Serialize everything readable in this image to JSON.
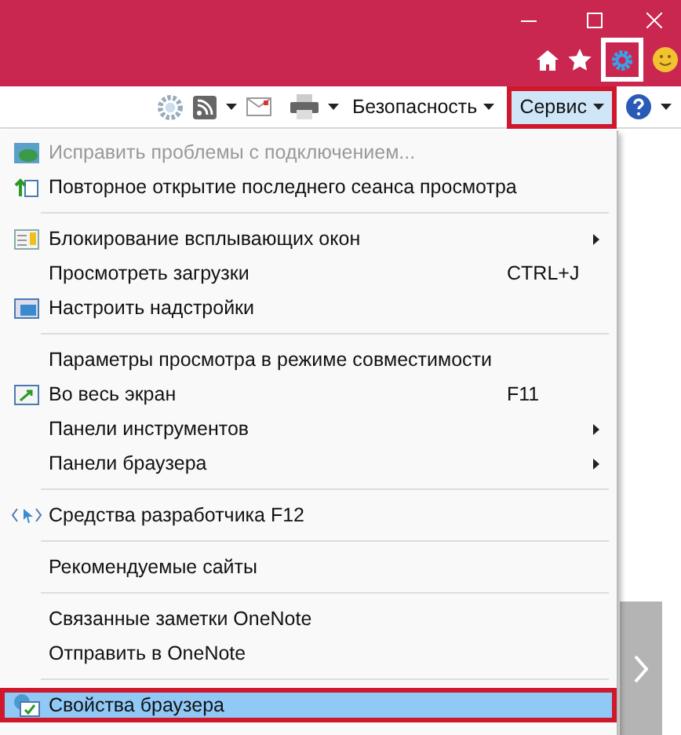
{
  "toolbar": {
    "buttons": [
      {
        "label": "Безопасность",
        "selected": false
      },
      {
        "label": "Сервис",
        "selected": true
      }
    ]
  },
  "menu": {
    "items": [
      {
        "kind": "item",
        "label": "Исправить проблемы с подключением...",
        "disabled": true,
        "submenu": false,
        "selected": false
      },
      {
        "kind": "item",
        "label": "Повторное открытие последнего сеанса просмотра",
        "disabled": false,
        "submenu": false,
        "selected": false
      },
      {
        "kind": "separator"
      },
      {
        "kind": "item",
        "label": "Блокирование всплывающих окон",
        "disabled": false,
        "submenu": true,
        "selected": false
      },
      {
        "kind": "item",
        "label": "Просмотреть загрузки",
        "shortcut": "CTRL+J",
        "disabled": false,
        "submenu": false,
        "selected": false
      },
      {
        "kind": "item",
        "label": "Настроить надстройки",
        "disabled": false,
        "submenu": false,
        "selected": false
      },
      {
        "kind": "separator"
      },
      {
        "kind": "item",
        "label": "Параметры просмотра в режиме совместимости",
        "disabled": false,
        "submenu": false,
        "selected": false
      },
      {
        "kind": "item",
        "label": "Во весь экран",
        "shortcut": "F11",
        "disabled": false,
        "submenu": false,
        "selected": false
      },
      {
        "kind": "item",
        "label": "Панели инструментов",
        "disabled": false,
        "submenu": true,
        "selected": false
      },
      {
        "kind": "item",
        "label": "Панели браузера",
        "disabled": false,
        "submenu": true,
        "selected": false
      },
      {
        "kind": "separator"
      },
      {
        "kind": "item",
        "label": "Средства разработчика F12",
        "disabled": false,
        "submenu": false,
        "selected": false
      },
      {
        "kind": "separator"
      },
      {
        "kind": "item",
        "label": "Рекомендуемые сайты",
        "disabled": false,
        "submenu": false,
        "selected": false
      },
      {
        "kind": "separator"
      },
      {
        "kind": "item",
        "label": "Связанные заметки OneNote",
        "disabled": false,
        "submenu": false,
        "selected": false
      },
      {
        "kind": "item",
        "label": "Отправить в OneNote",
        "disabled": false,
        "submenu": false,
        "selected": false
      },
      {
        "kind": "separator"
      },
      {
        "kind": "item",
        "label": "Свойства браузера",
        "disabled": false,
        "submenu": false,
        "selected": true
      }
    ]
  }
}
